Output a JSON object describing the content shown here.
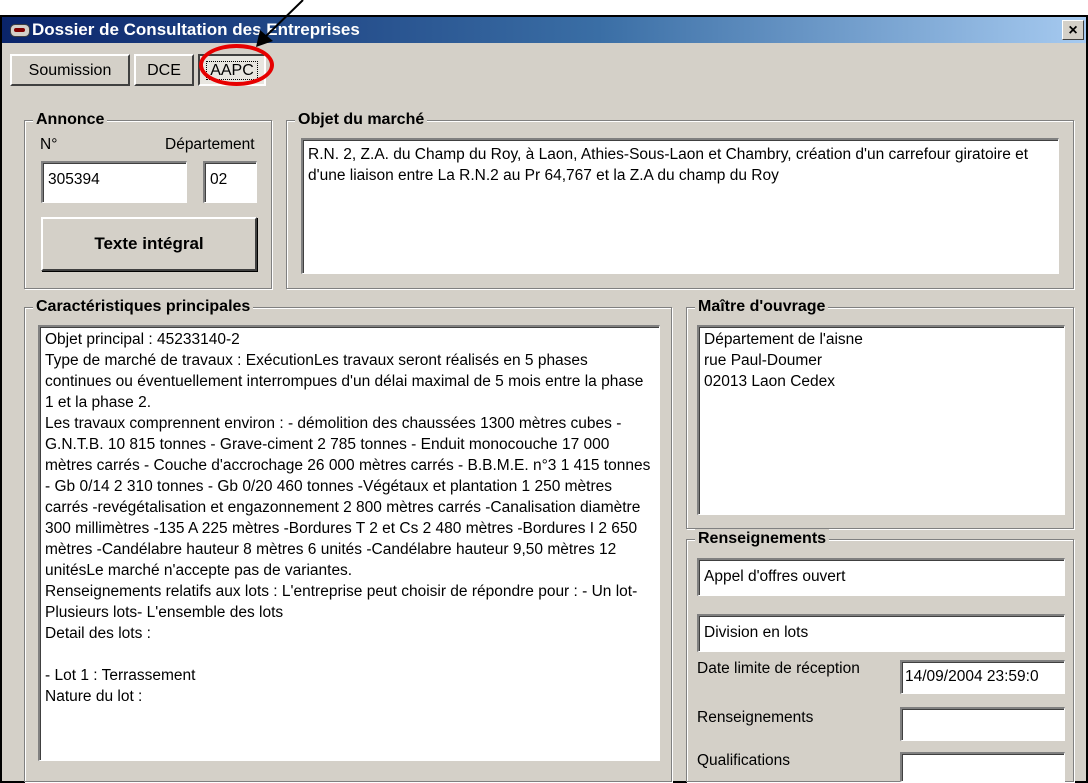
{
  "window": {
    "title": "Dossier de Consultation des Entreprises",
    "close_label": "×"
  },
  "tabs": [
    {
      "label": "Soumission"
    },
    {
      "label": "DCE"
    },
    {
      "label": "AAPC"
    }
  ],
  "annonce": {
    "legend": "Annonce",
    "num_label": "N°",
    "dept_label": "Département",
    "num_value": "305394",
    "dept_value": "02",
    "texte_button": "Texte intégral"
  },
  "objet": {
    "legend": "Objet du marché",
    "text": "R.N. 2, Z.A. du Champ du Roy, à Laon, Athies-Sous-Laon et Chambry, création d'un carrefour giratoire et d'une liaison entre La R.N.2 au Pr 64,767 et la Z.A du champ du Roy"
  },
  "caracteristiques": {
    "legend": "Caractéristiques principales",
    "text": "Objet principal : 45233140-2\nType de marché de travaux : ExécutionLes travaux seront réalisés en 5 phases continues ou éventuellement interrompues d'un délai maximal de 5 mois entre la phase 1 et la phase 2.\nLes travaux comprennent environ : - démolition des chaussées 1300 mètres cubes - G.N.T.B. 10 815 tonnes - Grave-ciment 2 785 tonnes - Enduit monocouche 17 000 mètres carrés - Couche d'accrochage 26 000 mètres carrés - B.B.M.E. n°3 1 415 tonnes - Gb 0/14 2 310 tonnes - Gb 0/20 460 tonnes -Végétaux et plantation 1 250 mètres carrés -revégétalisation et engazonnement 2 800 mètres carrés -Canalisation diamètre 300 millimètres -135 A 225 mètres -Bordures T 2 et Cs 2 480 mètres -Bordures I 2 650 mètres -Candélabre hauteur 8 mètres 6 unités -Candélabre hauteur 9,50 mètres 12 unitésLe marché n'accepte pas de variantes.\nRenseignements relatifs aux lots : L'entreprise peut choisir de répondre pour : - Un lot- Plusieurs lots- L'ensemble des lots\nDetail des lots :\n\n- Lot 1 : Terrassement\nNature du lot :"
  },
  "maitre": {
    "legend": "Maître d'ouvrage",
    "text": "Département de l'aisne\nrue Paul-Doumer\n02013 Laon Cedex"
  },
  "renseignements": {
    "legend": "Renseignements",
    "procedure": "Appel d'offres ouvert",
    "division": "Division en lots",
    "date_label": "Date limite de réception",
    "date_value": "14/09/2004 23:59:0",
    "rens_label": "Renseignements",
    "rens_value": "",
    "qualif_label": "Qualifications",
    "qualif_value": ""
  },
  "colors": {
    "annotation_red": "#e60000",
    "title_blue": "#0a246a",
    "face": "#d4d0c8"
  },
  "icons": {
    "app": "app-icon",
    "arrow": "annotation-arrow",
    "circle": "annotation-circle"
  }
}
